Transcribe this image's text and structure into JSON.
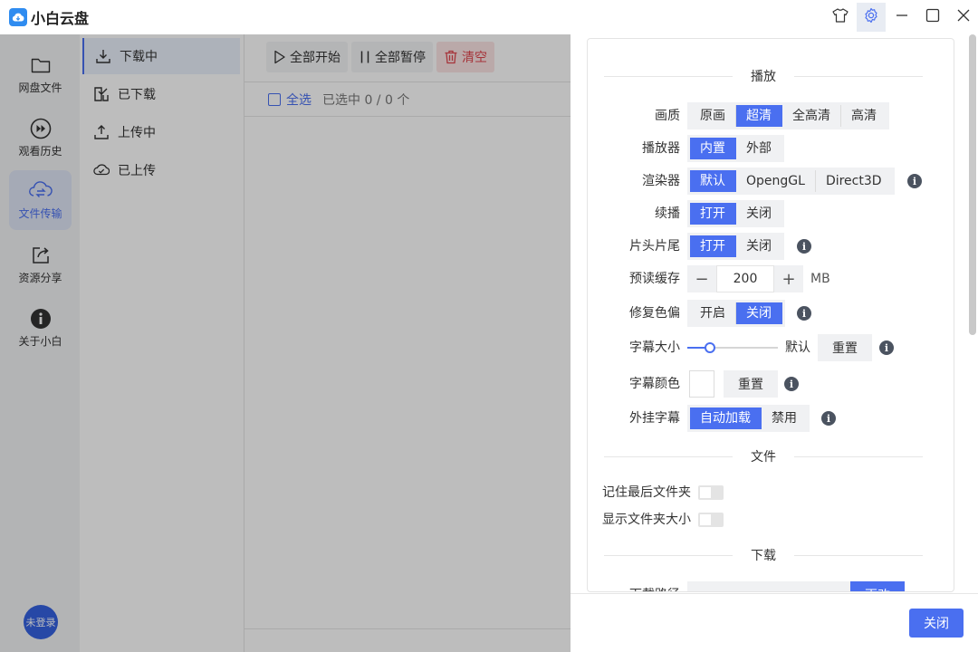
{
  "app": {
    "title": "小白云盘"
  },
  "titlebar": {
    "icons": [
      "shirt-icon",
      "gear-icon",
      "minimize-icon",
      "maximize-icon",
      "close-icon"
    ]
  },
  "sidebar": {
    "items": [
      {
        "label": "网盘文件",
        "icon": "folder-icon"
      },
      {
        "label": "观看历史",
        "icon": "play-history-icon"
      },
      {
        "label": "文件传输",
        "icon": "transfer-icon",
        "active": true
      },
      {
        "label": "资源分享",
        "icon": "share-icon"
      },
      {
        "label": "关于小白",
        "icon": "info-icon"
      }
    ],
    "user": "未登录"
  },
  "sublist": {
    "items": [
      {
        "label": "下载中",
        "icon": "download-icon",
        "active": true
      },
      {
        "label": "已下载",
        "icon": "downloaded-icon"
      },
      {
        "label": "上传中",
        "icon": "upload-icon"
      },
      {
        "label": "已上传",
        "icon": "cloud-upload-icon"
      }
    ]
  },
  "toolbar": {
    "start_all": "全部开始",
    "pause_all": "全部暂停",
    "clear": "清空",
    "select_all": "全选",
    "selected": "已选中 0 / 0 个"
  },
  "settings": {
    "sections": {
      "play": "播放",
      "file": "文件",
      "download": "下载"
    },
    "quality": {
      "label": "画质",
      "options": [
        "原画",
        "超清",
        "全高清",
        "高清"
      ],
      "selected": "超清"
    },
    "player": {
      "label": "播放器",
      "options": [
        "内置",
        "外部"
      ],
      "selected": "内置"
    },
    "renderer": {
      "label": "渲染器",
      "options": [
        "默认",
        "OpengGL",
        "Direct3D"
      ],
      "selected": "默认"
    },
    "resume": {
      "label": "续播",
      "options": [
        "打开",
        "关闭"
      ],
      "selected": "打开"
    },
    "skip_intro": {
      "label": "片头片尾",
      "options": [
        "打开",
        "关闭"
      ],
      "selected": "打开"
    },
    "preload": {
      "label": "预读缓存",
      "value": "200",
      "unit": "MB",
      "minus": "−",
      "plus": "+"
    },
    "fix_color": {
      "label": "修复色偏",
      "options": [
        "开启",
        "关闭"
      ],
      "selected": "关闭"
    },
    "subtitle_size": {
      "label": "字幕大小",
      "value_text": "默认",
      "reset": "重置",
      "level": 0.25
    },
    "subtitle_color": {
      "label": "字幕颜色",
      "color": "#ffffff",
      "reset": "重置"
    },
    "external_sub": {
      "label": "外挂字幕",
      "options": [
        "自动加载",
        "禁用"
      ],
      "selected": "自动加载"
    },
    "remember_folder": {
      "label": "记住最后文件夹",
      "on": false
    },
    "show_folder_size": {
      "label": "显示文件夹大小",
      "on": false
    },
    "download_path": {
      "label": "下载路径",
      "button": "更改"
    },
    "close": "关闭"
  },
  "colors": {
    "accent": "#4a6ff0",
    "danger": "#e0474f",
    "overlay": "rgba(0,0,0,0.26)"
  }
}
